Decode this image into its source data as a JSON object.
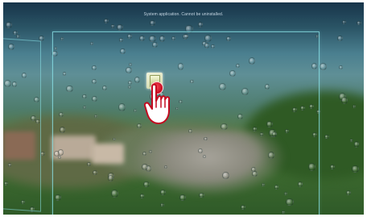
{
  "status_message": "System application. Cannot be uninstalled.",
  "colors": {
    "panel_border": "#8ce6eb",
    "touch_indicator": "#d0142c",
    "icon_background": "#e6ecc4"
  },
  "icons": {
    "app": "app-icon",
    "hand": "hand-pointer-icon"
  }
}
